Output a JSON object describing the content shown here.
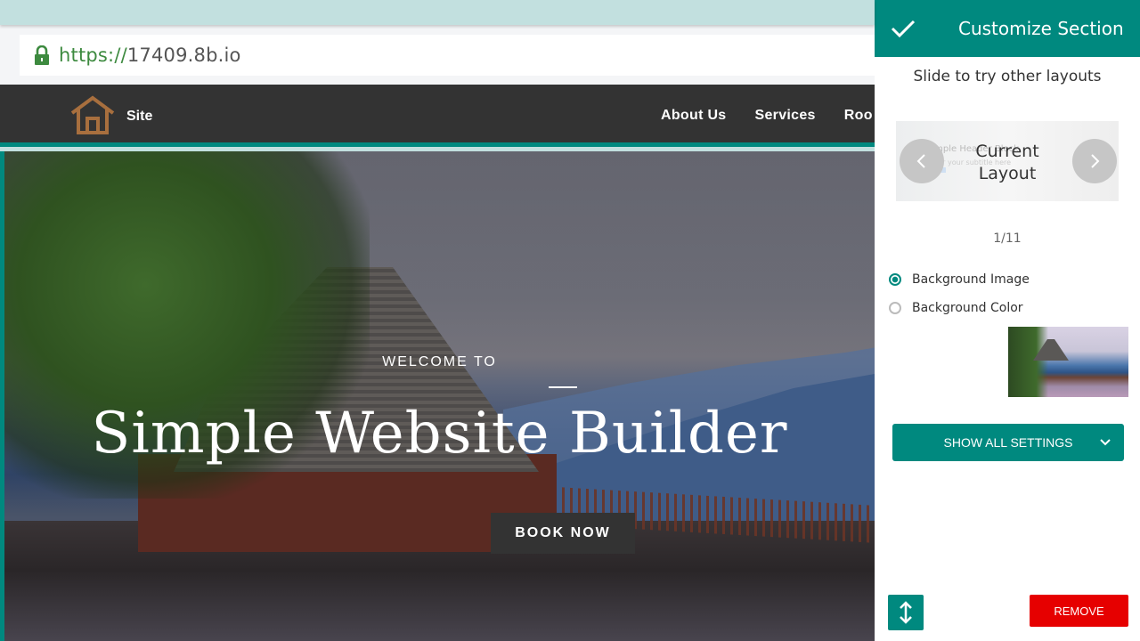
{
  "browser": {
    "url_scheme": "https://",
    "url_host": "17409.8b.io"
  },
  "site": {
    "brand": "Site",
    "nav": [
      "About Us",
      "Services",
      "Roo"
    ],
    "hero": {
      "eyebrow": "WELCOME TO",
      "title": "Simple Website Builder",
      "cta": "BOOK NOW"
    }
  },
  "panel": {
    "title": "Customize Section",
    "hint": "Slide to try other layouts",
    "slider": {
      "label_line1": "Current",
      "label_line2": "Layout",
      "ghost_title": "Simple Header Block",
      "ghost_subtitle": "Enter your subtitle here",
      "page": "1/11"
    },
    "background_options": [
      {
        "label": "Background Image",
        "selected": true
      },
      {
        "label": "Background Color",
        "selected": false
      }
    ],
    "show_all_settings": "SHOW ALL SETTINGS",
    "remove": "REMOVE"
  },
  "colors": {
    "accent": "#00897f",
    "danger": "#e60000",
    "nav_bg": "#333333",
    "logo": "#a86f3e"
  }
}
